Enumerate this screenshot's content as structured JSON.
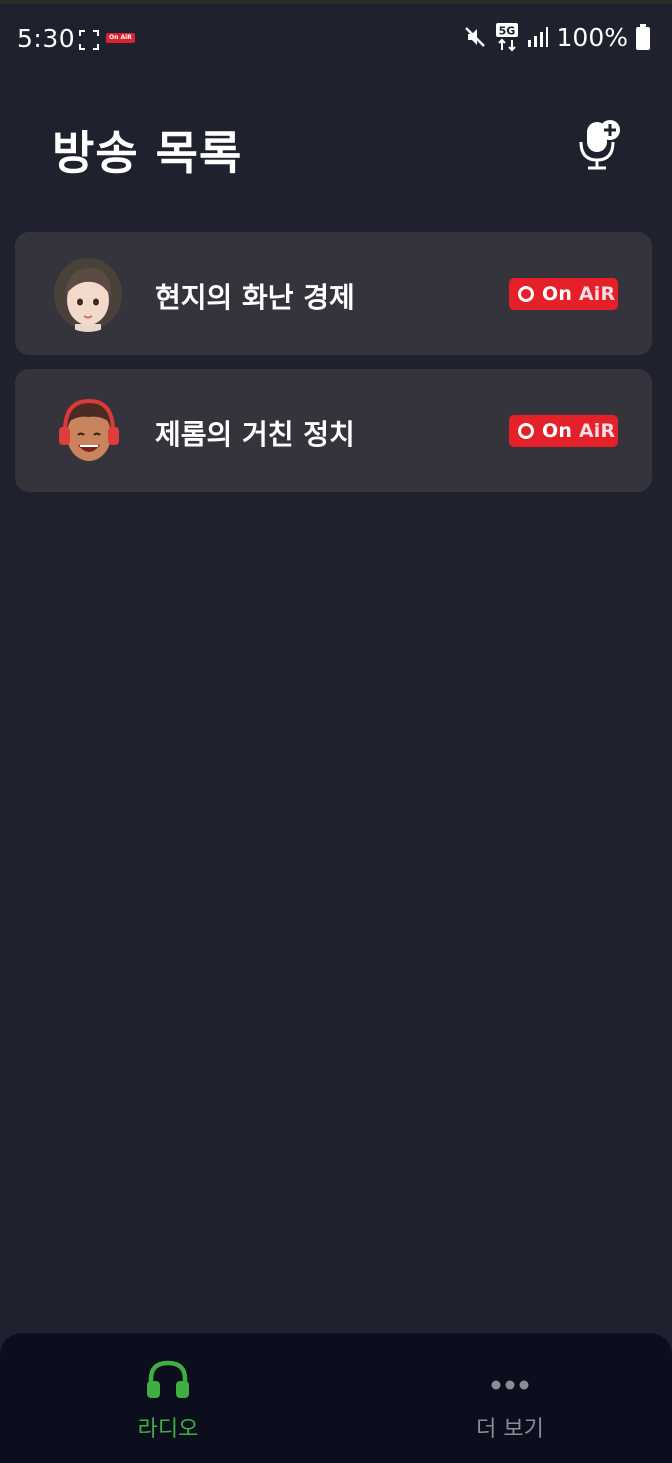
{
  "status_bar": {
    "time": "5:30",
    "mini_badge": "On AiR",
    "network": "5G",
    "battery": "100%"
  },
  "header": {
    "title": "방송 목록"
  },
  "broadcasts": [
    {
      "title": "현지의 화난 경제",
      "badge_on": "On ",
      "badge_air": "AiR",
      "avatar": "woman-avatar"
    },
    {
      "title": "제롬의 거친 정치",
      "badge_on": "On ",
      "badge_air": "AiR",
      "avatar": "man-headphones-avatar"
    }
  ],
  "tabbar": {
    "tabs": [
      {
        "label": "라디오",
        "icon": "headphones-icon",
        "active": true
      },
      {
        "label": "더 보기",
        "icon": "more-dots-icon",
        "active": false
      }
    ]
  },
  "colors": {
    "background": "#20212f",
    "card": "#35343d",
    "onair_red": "#e52029",
    "active_tab": "#3fae45",
    "inactive_tab": "#8a8c96"
  }
}
